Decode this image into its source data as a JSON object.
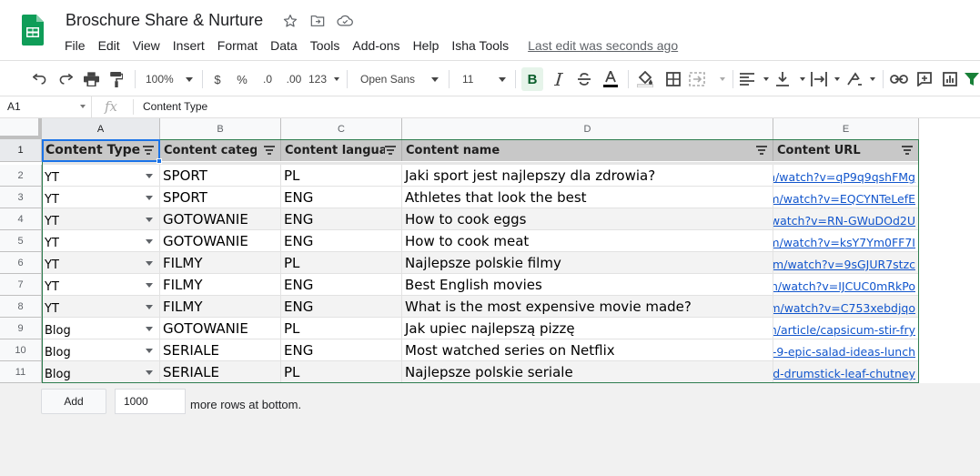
{
  "app": {
    "doc_title": "Broschure Share & Nurture",
    "last_edit": "Last edit was seconds ago",
    "brand_color": "#0f9d58"
  },
  "menu": [
    "File",
    "Edit",
    "View",
    "Insert",
    "Format",
    "Data",
    "Tools",
    "Add-ons",
    "Help",
    "Isha Tools"
  ],
  "toolbar": {
    "zoom": "100%",
    "currency": "$",
    "percent": "%",
    "decrease_decimal": ".0",
    "increase_decimal": ".00",
    "more_formats": "123",
    "font": "Open Sans",
    "font_size": "11",
    "bold": "B"
  },
  "formula_bar": {
    "cell_ref": "A1",
    "fx": "fx",
    "content": "Content Type"
  },
  "grid": {
    "columns": [
      "A",
      "B",
      "C",
      "D",
      "E"
    ],
    "rows": [
      "1",
      "2",
      "3",
      "4",
      "5",
      "6",
      "7",
      "8",
      "9",
      "10",
      "11"
    ],
    "headers": [
      "Content Type",
      "Content category",
      "Content language",
      "Content name",
      "Content URL"
    ],
    "data": [
      {
        "type": "YT",
        "category": "SPORT",
        "language": "PL",
        "name": "Jaki sport jest najlepszy dla zdrowia?",
        "url": "m/watch?v=qP9q9qshFMg"
      },
      {
        "type": "YT",
        "category": "SPORT",
        "language": "ENG",
        "name": "Athletes that look the best",
        "url": "m/watch?v=EQCYNTeLefE"
      },
      {
        "type": "YT",
        "category": "GOTOWANIE",
        "language": "ENG",
        "name": "How to cook eggs",
        "url": "watch?v=RN-GWuDOd2U"
      },
      {
        "type": "YT",
        "category": "GOTOWANIE",
        "language": "ENG",
        "name": "How to cook meat",
        "url": "m/watch?v=ksY7Ym0FF7I"
      },
      {
        "type": "YT",
        "category": "FILMY",
        "language": "PL",
        "name": "Najlepsze polskie filmy",
        "url": "om/watch?v=9sGJUR7stzc"
      },
      {
        "type": "YT",
        "category": "FILMY",
        "language": "ENG",
        "name": "Best English movies",
        "url": "m/watch?v=IJCUC0mRkPo"
      },
      {
        "type": "YT",
        "category": "FILMY",
        "language": "ENG",
        "name": "What is the most expensive movie made?",
        "url": "m/watch?v=C753xebdjqo"
      },
      {
        "type": "Blog",
        "category": "GOTOWANIE",
        "language": "PL",
        "name": "Jak upiec najlepszą pizzę",
        "url": "n/article/capsicum-stir-fry"
      },
      {
        "type": "Blog",
        "category": "SERIALE",
        "language": "ENG",
        "name": "Most watched series on Netflix",
        "url": "-9-epic-salad-ideas-lunch"
      },
      {
        "type": "Blog",
        "category": "SERIALE",
        "language": "PL",
        "name": "Najlepsze polskie seriale",
        "url": "d-drumstick-leaf-chutney"
      }
    ]
  },
  "footer": {
    "add_label": "Add",
    "rows_value": "1000",
    "more_rows_label": "more rows at bottom."
  }
}
